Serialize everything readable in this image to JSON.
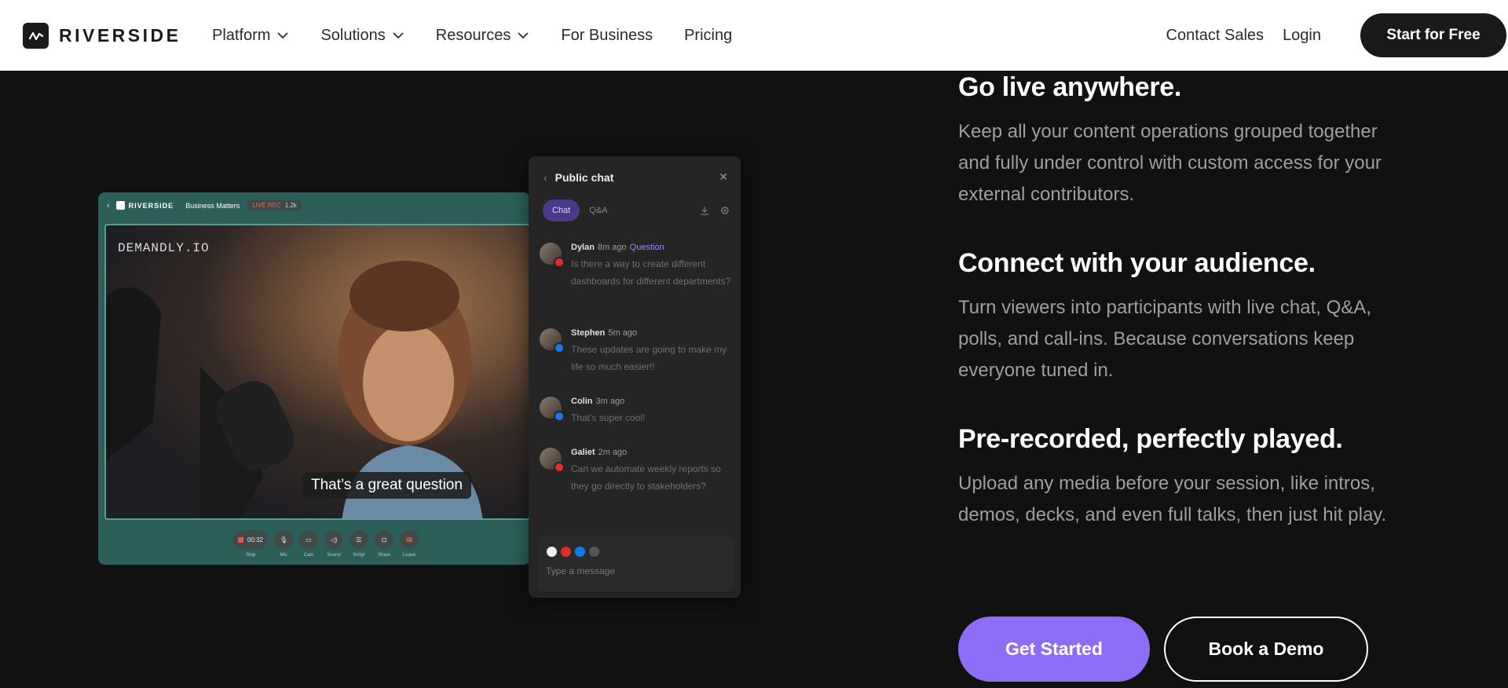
{
  "nav": {
    "logo_text": "RIVERSIDE",
    "items": [
      {
        "label": "Platform",
        "has_dropdown": true
      },
      {
        "label": "Solutions",
        "has_dropdown": true
      },
      {
        "label": "Resources",
        "has_dropdown": true
      },
      {
        "label": "For Business",
        "has_dropdown": false
      },
      {
        "label": "Pricing",
        "has_dropdown": false
      }
    ],
    "contact_sales": "Contact Sales",
    "login": "Login",
    "start_free": "Start for Free"
  },
  "studio": {
    "brand": "RIVERSIDE",
    "project": "Business Matters",
    "live_label": "LIVE REC",
    "viewer_count": "1.2k",
    "watermark": "DEMANDLY.IO",
    "caption": "That’s a great question",
    "controls": [
      {
        "label": "Stop",
        "value": "00:32"
      },
      {
        "label": "Mic"
      },
      {
        "label": "Cam"
      },
      {
        "label": "Sound"
      },
      {
        "label": "Script"
      },
      {
        "label": "Share"
      },
      {
        "label": "Leave"
      }
    ]
  },
  "chat": {
    "title": "Public chat",
    "tabs": [
      "Chat",
      "Q&A"
    ],
    "messages": [
      {
        "name": "Dylan",
        "time": "8m ago",
        "tag": "Question",
        "source": "youtube",
        "text": "Is there a way to create different dashboards for different departments?"
      },
      {
        "name": "Stephen",
        "time": "5m ago",
        "tag": "",
        "source": "facebook",
        "text": "These updates are going to make my life so much easier!!"
      },
      {
        "name": "Colin",
        "time": "3m ago",
        "tag": "",
        "source": "facebook",
        "text": "That’s super cool!"
      },
      {
        "name": "Galiet",
        "time": "2m ago",
        "tag": "",
        "source": "youtube",
        "text": "Can we automate weekly reports so they go directly to stakeholders?"
      }
    ],
    "input_placeholder": "Type a message"
  },
  "features": [
    {
      "title": "Go live anywhere.",
      "body": "Keep all your content operations grouped together and fully under control with custom access for your external contributors."
    },
    {
      "title": "Connect with your audience.",
      "body": "Turn viewers into participants with live chat, Q&A, polls, and call-ins. Because conversations keep everyone tuned in."
    },
    {
      "title": "Pre-recorded, perfectly played.",
      "body": "Upload any media before your session, like intros, demos, decks, and even full talks, then just hit play."
    }
  ],
  "cta": {
    "primary": "Get Started",
    "secondary": "Book a Demo"
  },
  "colors": {
    "accent": "#8e6df6",
    "background": "#111111",
    "studio": "#2c5f5a"
  }
}
